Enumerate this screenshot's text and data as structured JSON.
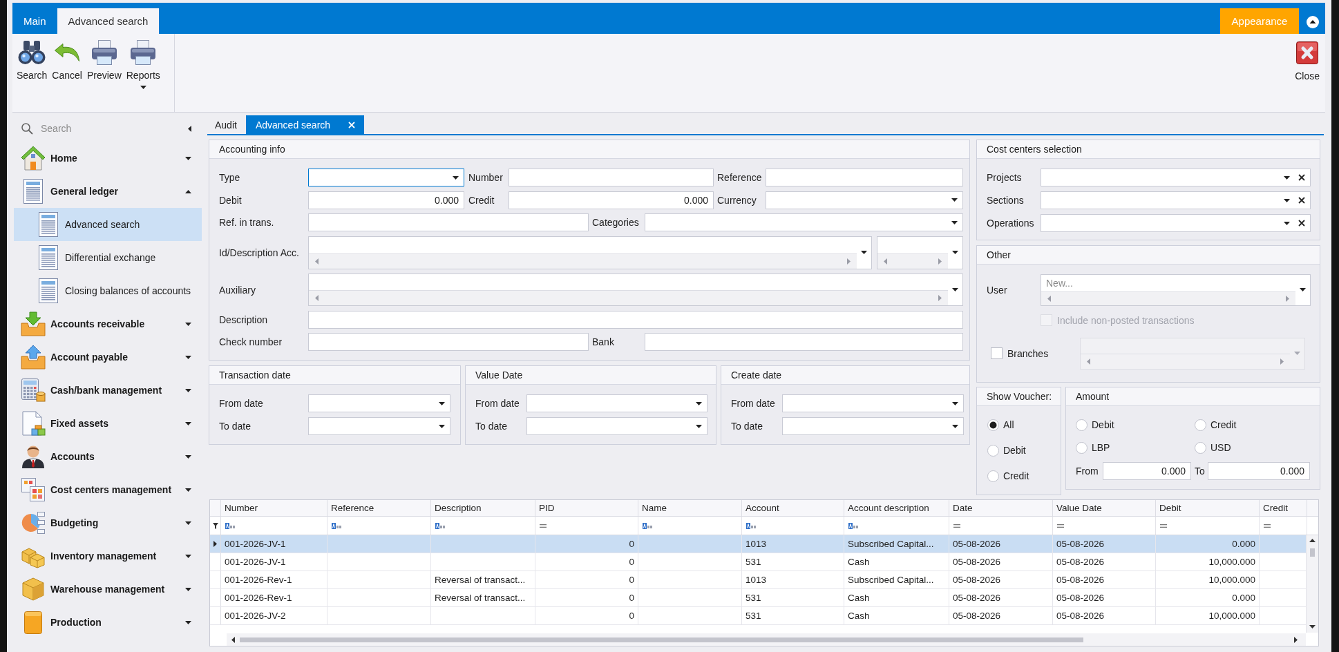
{
  "ribbon": {
    "tabs": [
      {
        "label": "Main",
        "selected": false
      },
      {
        "label": "Advanced search",
        "selected": true
      }
    ],
    "buttons": [
      {
        "label": "Search",
        "dropdown": false
      },
      {
        "label": "Cancel",
        "dropdown": false
      },
      {
        "label": "Preview",
        "dropdown": false
      },
      {
        "label": "Reports",
        "dropdown": true
      }
    ],
    "appearance": "Appearance",
    "close": "Close"
  },
  "sidebar": {
    "search": {
      "placeholder": "Search"
    },
    "items": [
      {
        "label": "Home",
        "expanded": false,
        "selected": false
      },
      {
        "label": "General ledger",
        "expanded": true,
        "selected": false,
        "children": [
          {
            "label": "Advanced search",
            "selected": true
          },
          {
            "label": "Differential exchange",
            "selected": false
          },
          {
            "label": "Closing balances of accounts",
            "selected": false
          }
        ]
      },
      {
        "label": "Accounts receivable",
        "expanded": false,
        "selected": false
      },
      {
        "label": "Account payable",
        "expanded": false,
        "selected": false
      },
      {
        "label": "Cash/bank management",
        "expanded": false,
        "selected": false
      },
      {
        "label": "Fixed assets",
        "expanded": false,
        "selected": false
      },
      {
        "label": "Accounts",
        "expanded": false,
        "selected": false
      },
      {
        "label": "Cost centers management",
        "expanded": false,
        "selected": false
      },
      {
        "label": "Budgeting",
        "expanded": false,
        "selected": false
      },
      {
        "label": "Inventory management",
        "expanded": false,
        "selected": false
      },
      {
        "label": "Warehouse management",
        "expanded": false,
        "selected": false
      },
      {
        "label": "Production",
        "expanded": false,
        "selected": false
      }
    ]
  },
  "document_tabs": [
    {
      "label": "Audit",
      "selected": false,
      "closable": false
    },
    {
      "label": "Advanced search",
      "selected": true,
      "closable": true
    }
  ],
  "accounting_info": {
    "title": "Accounting info",
    "type": {
      "label": "Type",
      "focused": true
    },
    "number": {
      "label": "Number"
    },
    "reference": {
      "label": "Reference"
    },
    "debit": {
      "label": "Debit",
      "value": "0.000"
    },
    "credit": {
      "label": "Credit",
      "value": "0.000"
    },
    "currency": {
      "label": "Currency"
    },
    "ref_in_trans": {
      "label": "Ref. in trans."
    },
    "categories": {
      "label": "Categories"
    },
    "id_description_acc": {
      "label": "Id/Description Acc."
    },
    "auxiliary": {
      "label": "Auxiliary"
    },
    "description": {
      "label": "Description"
    },
    "check_number": {
      "label": "Check number"
    },
    "bank": {
      "label": "Bank"
    }
  },
  "date_ranges": [
    {
      "title": "Transaction date",
      "from_label": "From date",
      "to_label": "To date"
    },
    {
      "title": "Value Date",
      "from_label": "From date",
      "to_label": "To date"
    },
    {
      "title": "Create date",
      "from_label": "From date",
      "to_label": "To date"
    }
  ],
  "cost_centers": {
    "title": "Cost centers selection",
    "fields": [
      {
        "label": "Projects"
      },
      {
        "label": "Sections"
      },
      {
        "label": "Operations"
      }
    ]
  },
  "other": {
    "title": "Other",
    "user": {
      "label": "User",
      "placeholder": "New..."
    },
    "include_non_posted": {
      "label": "Include non-posted transactions",
      "checked": false,
      "disabled": true
    },
    "branches": {
      "label": "Branches",
      "checked": false
    }
  },
  "show_voucher": {
    "title": "Show Voucher:",
    "options": [
      {
        "label": "All",
        "selected": true
      },
      {
        "label": "Debit",
        "selected": false
      },
      {
        "label": "Credit",
        "selected": false
      }
    ]
  },
  "amount": {
    "title": "Amount",
    "options": [
      {
        "label": "Debit",
        "selected": false
      },
      {
        "label": "Credit",
        "selected": false
      },
      {
        "label": "LBP",
        "selected": false
      },
      {
        "label": "USD",
        "selected": false
      }
    ],
    "from": {
      "label": "From",
      "value": "0.000"
    },
    "to": {
      "label": "To",
      "value": "0.000"
    }
  },
  "table": {
    "columns": [
      {
        "label": "Number",
        "kind": "text"
      },
      {
        "label": "Reference",
        "kind": "text"
      },
      {
        "label": "Description",
        "kind": "text"
      },
      {
        "label": "PID",
        "kind": "number"
      },
      {
        "label": "Name",
        "kind": "text"
      },
      {
        "label": "Account",
        "kind": "text"
      },
      {
        "label": "Account description",
        "kind": "text"
      },
      {
        "label": "Date",
        "kind": "number"
      },
      {
        "label": "Value Date",
        "kind": "number"
      },
      {
        "label": "Debit",
        "kind": "number"
      },
      {
        "label": "Credit",
        "kind": "number"
      }
    ],
    "rows": [
      {
        "selected": true,
        "number": "001-2026-JV-1",
        "pid": "0",
        "account": "1013",
        "account_description": "Subscribed Capital...",
        "date": "05-08-2026",
        "value_date": "05-08-2026",
        "debit": "0.000"
      },
      {
        "selected": false,
        "number": "001-2026-JV-1",
        "pid": "0",
        "account": "531",
        "account_description": "Cash",
        "date": "05-08-2026",
        "value_date": "05-08-2026",
        "debit": "10,000.000"
      },
      {
        "selected": false,
        "number": "001-2026-Rev-1",
        "description": "Reversal of transact...",
        "pid": "0",
        "account": "1013",
        "account_description": "Subscribed Capital...",
        "date": "05-08-2026",
        "value_date": "05-08-2026",
        "debit": "10,000.000"
      },
      {
        "selected": false,
        "number": "001-2026-Rev-1",
        "description": "Reversal of transact...",
        "pid": "0",
        "account": "531",
        "account_description": "Cash",
        "date": "05-08-2026",
        "value_date": "05-08-2026",
        "debit": "0.000"
      },
      {
        "selected": false,
        "number": "001-2026-JV-2",
        "pid": "0",
        "account": "531",
        "account_description": "Cash",
        "date": "05-08-2026",
        "value_date": "05-08-2026",
        "debit": "10,000.000"
      }
    ]
  }
}
